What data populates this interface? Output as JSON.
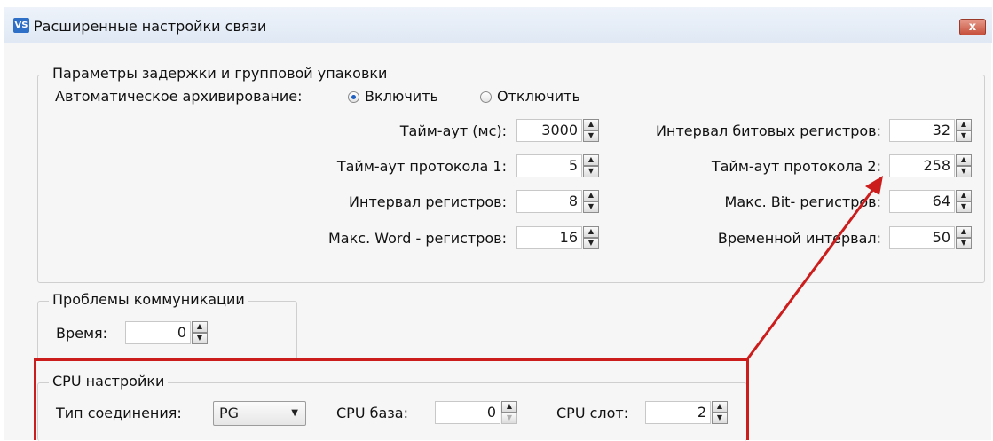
{
  "window": {
    "title": "Расширенные настройки связи",
    "app_icon": "VS",
    "close_glyph": "x"
  },
  "delay_group": {
    "legend": "Параметры задержки и групповой упаковки",
    "auto_archive_label": "Автоматическое архивирование:",
    "enable_label": "Включить",
    "disable_label": "Отключить",
    "selected": "Включить",
    "timeout_label": "Тайм-аут (мс):",
    "timeout_value": "3000",
    "bit_interval_label": "Интервал битовых регистров:",
    "bit_interval_value": "32",
    "proto1_label": "Тайм-аут протокола 1:",
    "proto1_value": "5",
    "proto2_label": "Тайм-аут протокола 2:",
    "proto2_value": "258",
    "reg_interval_label": "Интервал регистров:",
    "reg_interval_value": "8",
    "max_bit_label": "Макс. Bit- регистров:",
    "max_bit_value": "64",
    "max_word_label": "Макс. Word - регистров:",
    "max_word_value": "16",
    "time_interval_label": "Временной интервал:",
    "time_interval_value": "50"
  },
  "comm_group": {
    "legend": "Проблемы коммуникации",
    "time_label": "Время:",
    "time_value": "0"
  },
  "cpu_group": {
    "legend": "CPU настройки",
    "conn_type_label": "Тип соединения:",
    "conn_type_value": "PG",
    "cpu_base_label": "CPU база:",
    "cpu_base_value": "0",
    "cpu_slot_label": "CPU слот:",
    "cpu_slot_value": "2"
  },
  "colors": {
    "highlight": "#cc1d1d",
    "radio_selected": "#1f5fbf"
  },
  "icons": [
    "app-logo-icon",
    "close-icon",
    "spin-up-icon",
    "spin-down-icon",
    "dropdown-caret-icon"
  ]
}
